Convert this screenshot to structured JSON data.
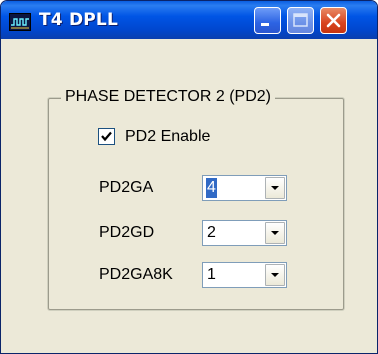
{
  "window": {
    "title": "T4 DPLL",
    "icon": "waveform-icon",
    "controls": {
      "minimize": "minimize-icon",
      "maximize": "maximize-icon",
      "close": "close-icon"
    }
  },
  "group": {
    "legend": "PHASE DETECTOR 2 (PD2)",
    "enable": {
      "label": "PD2 Enable",
      "checked": true
    },
    "fields": [
      {
        "label": "PD2GA",
        "value": "4",
        "focused": true
      },
      {
        "label": "PD2GD",
        "value": "2",
        "focused": false
      },
      {
        "label": "PD2GA8K",
        "value": "1",
        "focused": false
      }
    ]
  },
  "colors": {
    "titlebar": "#0055e5",
    "close_button": "#d9441f",
    "window_bg": "#ece9d8",
    "selection": "#316ac5"
  }
}
